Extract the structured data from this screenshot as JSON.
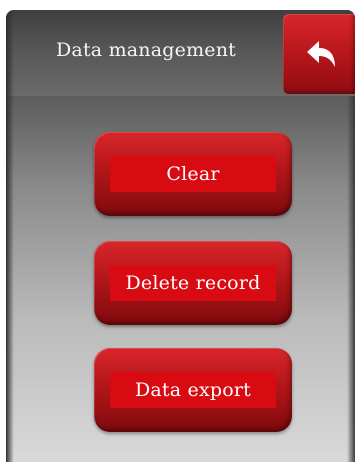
{
  "header": {
    "title": "Data management",
    "back_icon": "back-arrow-icon"
  },
  "actions": {
    "clear": "Clear",
    "delete_record": "Delete record",
    "data_export": "Data export"
  },
  "colors": {
    "accent_red": "#c8161b",
    "label_red": "#d90b12",
    "header_gray": "#4a4a4a",
    "text_white": "#ffffff"
  }
}
